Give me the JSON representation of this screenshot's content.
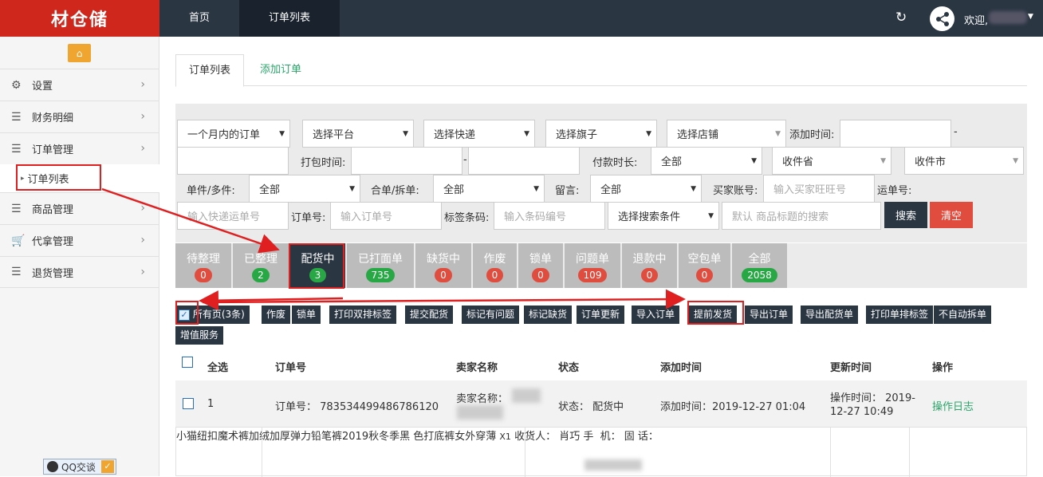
{
  "header": {
    "logo": "材仓储",
    "nav": [
      "首页",
      "订单列表"
    ],
    "welcome": "欢迎,"
  },
  "sidebar": {
    "items": [
      {
        "label": "设置",
        "icon": "gear-icon"
      },
      {
        "label": "财务明细",
        "icon": "list-icon"
      },
      {
        "label": "订单管理",
        "icon": "list-icon"
      },
      {
        "label": "商品管理",
        "icon": "list-icon"
      },
      {
        "label": "代拿管理",
        "icon": "cart-icon"
      },
      {
        "label": "退货管理",
        "icon": "list-icon"
      }
    ],
    "sub_item": "订单列表",
    "qq": "QQ交谈"
  },
  "tabs": [
    "订单列表",
    "添加订单"
  ],
  "filters": {
    "range": "一个月内的订单",
    "platform": "选择平台",
    "express": "选择快递",
    "flag": "选择旗子",
    "shop": "选择店铺",
    "add_time_label": "添加时间:",
    "pack_time_label": "打包时间:",
    "pay_duration_label": "付款时长:",
    "pay_duration_value": "全部",
    "province": "收件省",
    "city": "收件市",
    "single_multi_label": "单件/多件:",
    "single_multi_value": "全部",
    "merge_split_label": "合单/拆单:",
    "merge_split_value": "全部",
    "message_label": "留言:",
    "message_value": "全部",
    "buyer_label": "买家账号:",
    "buyer_placeholder": "输入买家旺旺号",
    "tracking_label": "运单号:",
    "tracking_placeholder": "输入快递运单号",
    "order_label": "订单号:",
    "order_placeholder": "输入订单号",
    "barcode_label": "标签条码:",
    "barcode_placeholder": "输入条码编号",
    "search_cond": "选择搜索条件",
    "keyword_placeholder": "默认 商品标题的搜索",
    "search_btn": "搜索",
    "clear_btn": "清空"
  },
  "status_tabs": [
    {
      "label": "待整理",
      "count": "0",
      "color": "red"
    },
    {
      "label": "已整理",
      "count": "2",
      "color": "green"
    },
    {
      "label": "配货中",
      "count": "3",
      "color": "green"
    },
    {
      "label": "已打面单",
      "count": "735",
      "color": "green"
    },
    {
      "label": "缺货中",
      "count": "0",
      "color": "red"
    },
    {
      "label": "作废",
      "count": "0",
      "color": "red"
    },
    {
      "label": "锁单",
      "count": "0",
      "color": "red"
    },
    {
      "label": "问题单",
      "count": "109",
      "color": "red"
    },
    {
      "label": "退款中",
      "count": "0",
      "color": "red"
    },
    {
      "label": "空包单",
      "count": "0",
      "color": "red"
    },
    {
      "label": "全部",
      "count": "2058",
      "color": "green"
    }
  ],
  "actions": {
    "all_pages": "所有页(3条)",
    "buttons": [
      "作废",
      "锁单",
      "打印双排标签",
      "提交配货",
      "标记有问题",
      "标记缺货",
      "订单更新",
      "导入订单",
      "提前发货",
      "导出订单",
      "导出配货单",
      "打印单排标签",
      "不自动拆单",
      "增值服务"
    ]
  },
  "table": {
    "headers": [
      "全选",
      "订单号",
      "卖家名称",
      "状态",
      "添加时间",
      "更新时间",
      "操作"
    ],
    "row": {
      "index": "1",
      "order_no": "订单号： 783534499486786120",
      "seller": "卖家名称：",
      "status": "状态： 配货中",
      "add_time": "添加时间：2019-12-27 01:04",
      "op_time_1": "操作时间： 2019-",
      "op_time_2": "12-27 10:49",
      "op_log": "操作日志"
    },
    "detail": {
      "product_1": "小猫纽扣魔术裤加绒加厚弹力铅笔裤2019秋冬季黑",
      "product_2": "色打底裤女外穿薄",
      "qty": "X1",
      "receiver": "收货人： 肖巧",
      "phone_label": "手  机：",
      "tel_label": "固 话："
    }
  }
}
